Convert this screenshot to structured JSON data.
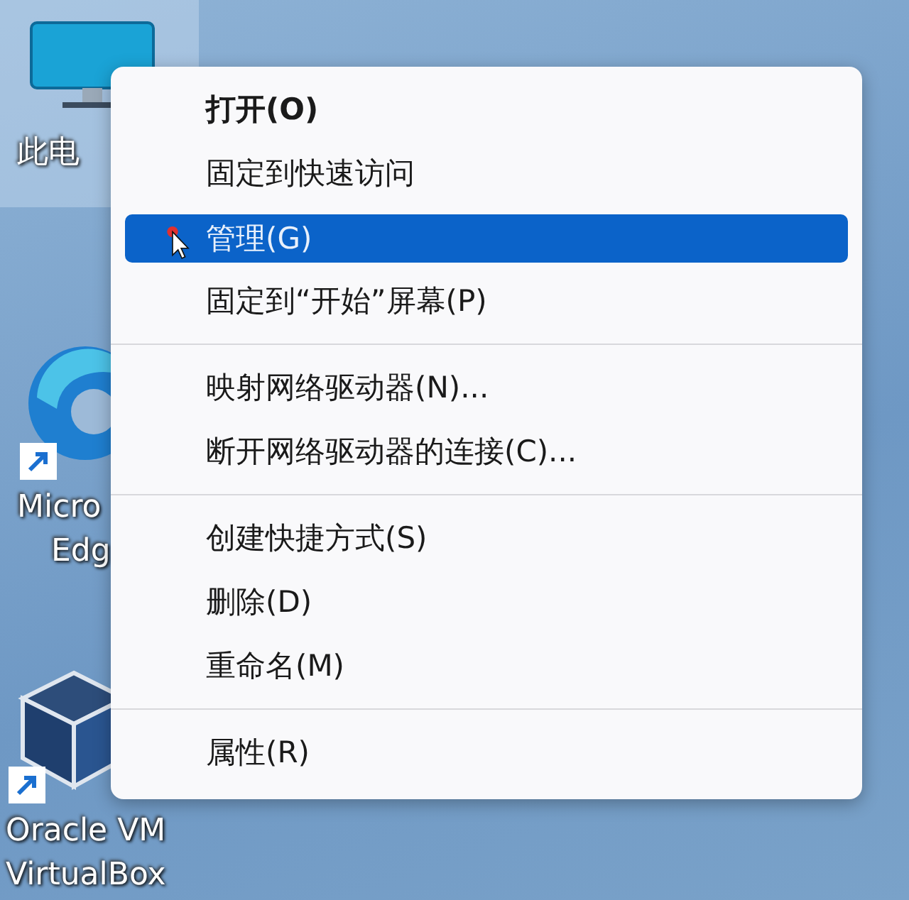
{
  "desktop_icons": [
    {
      "kind": "computer",
      "label_lines": [
        "此电"
      ],
      "selected": true
    },
    {
      "kind": "browser",
      "label_lines": [
        "Micro",
        "Edg"
      ],
      "selected": false,
      "shortcut": true
    },
    {
      "kind": "cube",
      "label_lines": [
        "Oracle VM",
        "VirtualBox"
      ],
      "selected": false,
      "shortcut": true
    }
  ],
  "context_menu": {
    "items": [
      {
        "kind": "item",
        "label": "打开(O)",
        "bold": true,
        "selected": false
      },
      {
        "kind": "item",
        "label": "固定到快速访问",
        "bold": false,
        "selected": false
      },
      {
        "kind": "item",
        "label": "管理(G)",
        "bold": false,
        "selected": true
      },
      {
        "kind": "item",
        "label": "固定到“开始”屏幕(P)",
        "bold": false,
        "selected": false
      },
      {
        "kind": "separator"
      },
      {
        "kind": "item",
        "label": "映射网络驱动器(N)...",
        "bold": false,
        "selected": false
      },
      {
        "kind": "item",
        "label": "断开网络驱动器的连接(C)...",
        "bold": false,
        "selected": false
      },
      {
        "kind": "separator"
      },
      {
        "kind": "item",
        "label": "创建快捷方式(S)",
        "bold": false,
        "selected": false
      },
      {
        "kind": "item",
        "label": "删除(D)",
        "bold": false,
        "selected": false
      },
      {
        "kind": "item",
        "label": "重命名(M)",
        "bold": false,
        "selected": false
      },
      {
        "kind": "separator"
      },
      {
        "kind": "item",
        "label": "属性(R)",
        "bold": false,
        "selected": false
      }
    ]
  }
}
